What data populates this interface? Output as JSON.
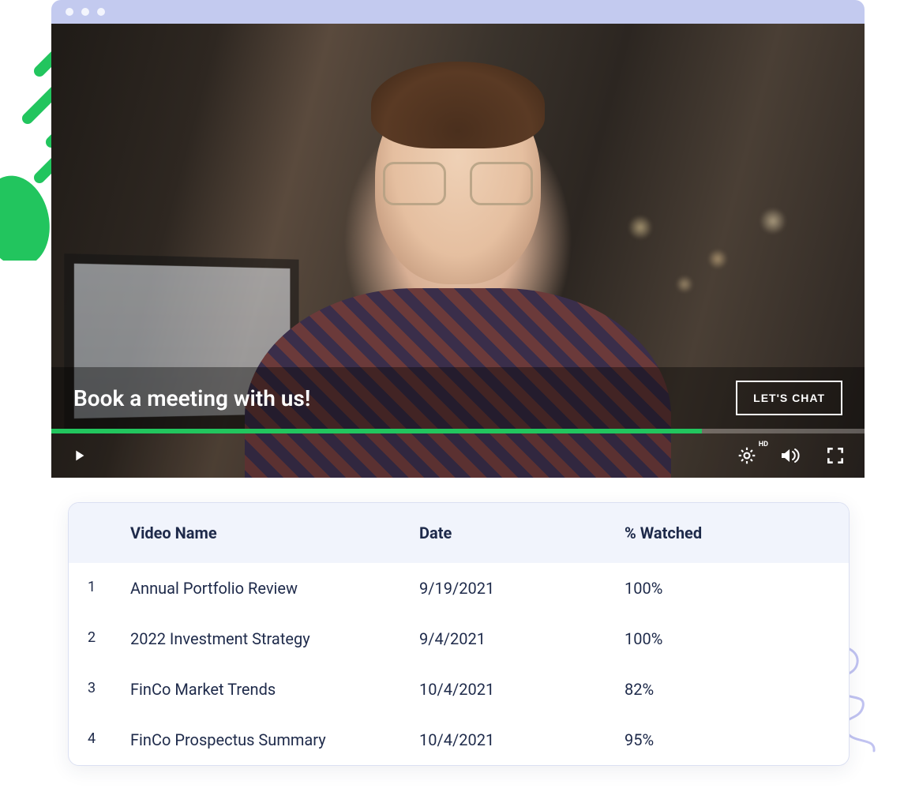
{
  "video": {
    "cta_text": "Book a meeting with us!",
    "cta_button": "LET'S CHAT",
    "hd_label": "HD",
    "progress_pct": 80
  },
  "table": {
    "headers": {
      "name": "Video Name",
      "date": "Date",
      "watched": "% Watched"
    },
    "rows": [
      {
        "idx": "1",
        "name": "Annual Portfolio Review",
        "date": "9/19/2021",
        "watched": "100%"
      },
      {
        "idx": "2",
        "name": "2022 Investment Strategy",
        "date": "9/4/2021",
        "watched": "100%"
      },
      {
        "idx": "3",
        "name": "FinCo Market Trends",
        "date": "10/4/2021",
        "watched": "82%"
      },
      {
        "idx": "4",
        "name": "FinCo Prospectus Summary",
        "date": "10/4/2021",
        "watched": "95%"
      }
    ]
  },
  "colors": {
    "accent_green": "#22c55e",
    "chrome_lilac": "#c3caef",
    "text_navy": "#1e2a4a"
  }
}
